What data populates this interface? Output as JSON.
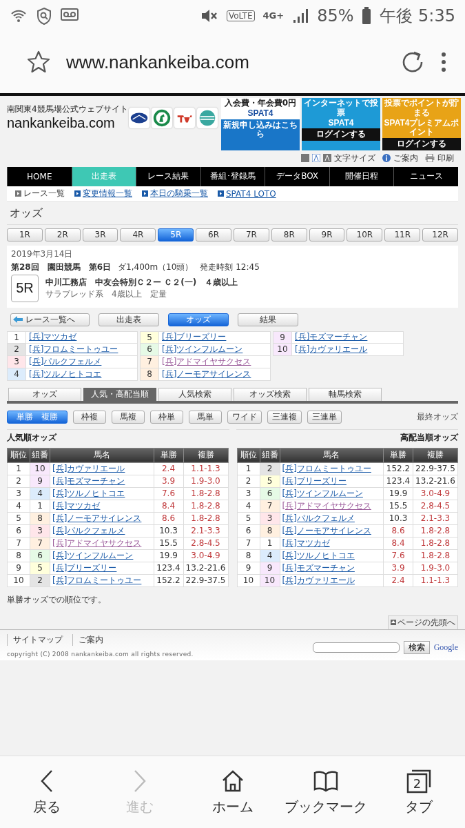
{
  "status_bar": {
    "volte": "VoLTE",
    "network": "4G+",
    "battery": "85%",
    "time": "午後 5:35"
  },
  "browser": {
    "url": "www.nankankeiba.com"
  },
  "site": {
    "tagline": "南関東4競馬場公式ウェブサイト",
    "logo": "nankankeiba.com",
    "banners": [
      {
        "top": "入会費・年会費0円",
        "title": "SPAT4",
        "bottom": "新規申し込みはこちら",
        "color": "#1976c8"
      },
      {
        "top": "インターネットで投票",
        "title": "SPAT4",
        "bottom": "ログインする",
        "color": "#1e9ad6"
      },
      {
        "top": "投票でポイントが貯まる",
        "title": "SPAT4プレミアムポイント",
        "bottom": "ログインする",
        "color": "#e8a317"
      }
    ],
    "tools": [
      "文字サイズ",
      "ご案内",
      "印刷"
    ]
  },
  "nav": [
    {
      "label": "HOME",
      "selected": false
    },
    {
      "label": "出走表",
      "selected": true
    },
    {
      "label": "レース結果",
      "selected": false
    },
    {
      "label": "番組･登録馬",
      "selected": false
    },
    {
      "label": "データBOX",
      "selected": false
    },
    {
      "label": "開催日程",
      "selected": false
    },
    {
      "label": "ニュース",
      "selected": false
    }
  ],
  "subnav": [
    {
      "label": "レース一覧",
      "kind": "current"
    },
    {
      "label": "変更情報一覧",
      "kind": "link"
    },
    {
      "label": "本日の騎乗一覧",
      "kind": "link"
    },
    {
      "label": "SPAT4 LOTO",
      "kind": "link"
    }
  ],
  "page_title": "オッズ",
  "race_tabs": [
    {
      "label": "1R",
      "selected": false
    },
    {
      "label": "2R",
      "selected": false
    },
    {
      "label": "3R",
      "selected": false
    },
    {
      "label": "4R",
      "selected": false
    },
    {
      "label": "5R",
      "selected": true
    },
    {
      "label": "6R",
      "selected": false
    },
    {
      "label": "7R",
      "selected": false
    },
    {
      "label": "8R",
      "selected": false
    },
    {
      "label": "9R",
      "selected": false
    },
    {
      "label": "10R",
      "selected": false
    },
    {
      "label": "11R",
      "selected": false
    },
    {
      "label": "12R",
      "selected": false
    }
  ],
  "race": {
    "date": "2019年3月14日",
    "meeting": "第28回　園田競馬　第6日",
    "course": "ダ1,400m（10頭）",
    "start": "発走時刻 12:45",
    "number": "5R",
    "name": "中川工務店　中友会特別Ｃ２ー Ｃ２(一)　４歳以上",
    "conditions": "サラブレッド系　4歳以上　定量"
  },
  "race_links": [
    {
      "label": "レース一覧へ",
      "kind": "back",
      "selected": false
    },
    {
      "label": "出走表",
      "kind": "plain",
      "selected": false
    },
    {
      "label": "オッズ",
      "kind": "plain",
      "selected": true
    },
    {
      "label": "結果",
      "kind": "plain",
      "selected": false
    }
  ],
  "entries": [
    {
      "number": "1",
      "name": "[兵]マツカゼ",
      "color": "#ffffff",
      "visited": false
    },
    {
      "number": "2",
      "name": "[兵]フロムミートゥユー",
      "color": "#e4e4e4",
      "visited": false
    },
    {
      "number": "3",
      "name": "[兵]パルクフェルメ",
      "color": "#ffe6ea",
      "visited": false
    },
    {
      "number": "4",
      "name": "[兵]ツルノヒトコエ",
      "color": "#dcecfc",
      "visited": false
    },
    {
      "number": "5",
      "name": "[兵]ブリーズリー",
      "color": "#ffffdc",
      "visited": false
    },
    {
      "number": "6",
      "name": "[兵]ツインフルムーン",
      "color": "#e6fae6",
      "visited": false
    },
    {
      "number": "7",
      "name": "[兵]アドマイヤサクセス",
      "color": "#fff0e0",
      "visited": true
    },
    {
      "number": "8",
      "name": "[兵]ノーモアサイレンス",
      "color": "#fff0e0",
      "visited": false
    },
    {
      "number": "9",
      "name": "[兵]モズマーチャン",
      "color": "#f8e8fc",
      "visited": false
    },
    {
      "number": "10",
      "name": "[兵]カヴァリエール",
      "color": "#f8e8fc",
      "visited": false
    }
  ],
  "odds_tabs": [
    {
      "label": "オッズ",
      "selected": false
    },
    {
      "label": "人気・高配当順",
      "selected": true
    },
    {
      "label": "人気検索",
      "selected": false
    },
    {
      "label": "オッズ検索",
      "selected": false
    },
    {
      "label": "軸馬検索",
      "selected": false
    }
  ],
  "bet_types": [
    {
      "label": "単勝　複勝",
      "selected": true
    },
    {
      "label": "枠複",
      "selected": false
    },
    {
      "label": "馬複",
      "selected": false
    },
    {
      "label": "枠単",
      "selected": false
    },
    {
      "label": "馬単",
      "selected": false
    },
    {
      "label": "ワイド",
      "selected": false
    },
    {
      "label": "三連複",
      "selected": false
    },
    {
      "label": "三連単",
      "selected": false
    }
  ],
  "odds_note": "最終オッズ",
  "tables": [
    {
      "title": "人気順オッズ",
      "columns": [
        "順位",
        "組番",
        "馬名",
        "単勝",
        "複勝"
      ],
      "rows": [
        {
          "rank": "1",
          "number": "10",
          "color": "#f8e8fc",
          "name": "[兵]カヴァリエール",
          "visited": false,
          "win": "2.4",
          "win_highlight": true,
          "place": "1.1-1.3",
          "place_highlight": true
        },
        {
          "rank": "2",
          "number": "9",
          "color": "#f8e8fc",
          "name": "[兵]モズマーチャン",
          "visited": false,
          "win": "3.9",
          "win_highlight": true,
          "place": "1.9-3.0",
          "place_highlight": true
        },
        {
          "rank": "3",
          "number": "4",
          "color": "#dcecfc",
          "name": "[兵]ツルノヒトコエ",
          "visited": false,
          "win": "7.6",
          "win_highlight": true,
          "place": "1.8-2.8",
          "place_highlight": true
        },
        {
          "rank": "4",
          "number": "1",
          "color": "#ffffff",
          "name": "[兵]マツカゼ",
          "visited": false,
          "win": "8.4",
          "win_highlight": true,
          "place": "1.8-2.8",
          "place_highlight": true
        },
        {
          "rank": "5",
          "number": "8",
          "color": "#fff0e0",
          "name": "[兵]ノーモアサイレンス",
          "visited": false,
          "win": "8.6",
          "win_highlight": true,
          "place": "1.8-2.8",
          "place_highlight": true
        },
        {
          "rank": "6",
          "number": "3",
          "color": "#ffe6ea",
          "name": "[兵]パルクフェルメ",
          "visited": false,
          "win": "10.3",
          "win_highlight": false,
          "place": "2.1-3.3",
          "place_highlight": true
        },
        {
          "rank": "7",
          "number": "7",
          "color": "#fff0e0",
          "name": "[兵]アドマイヤサクセス",
          "visited": true,
          "win": "15.5",
          "win_highlight": false,
          "place": "2.8-4.5",
          "place_highlight": true
        },
        {
          "rank": "8",
          "number": "6",
          "color": "#e6fae6",
          "name": "[兵]ツインフルムーン",
          "visited": false,
          "win": "19.9",
          "win_highlight": false,
          "place": "3.0-4.9",
          "place_highlight": true
        },
        {
          "rank": "9",
          "number": "5",
          "color": "#ffffdc",
          "name": "[兵]ブリーズリー",
          "visited": false,
          "win": "123.4",
          "win_highlight": false,
          "place": "13.2-21.6",
          "place_highlight": false
        },
        {
          "rank": "10",
          "number": "2",
          "color": "#e4e4e4",
          "name": "[兵]フロムミートゥユー",
          "visited": false,
          "win": "152.2",
          "win_highlight": false,
          "place": "22.9-37.5",
          "place_highlight": false
        }
      ]
    },
    {
      "title": "高配当順オッズ",
      "columns": [
        "順位",
        "組番",
        "馬名",
        "単勝",
        "複勝"
      ],
      "rows": [
        {
          "rank": "1",
          "number": "2",
          "color": "#e4e4e4",
          "name": "[兵]フロムミートゥユー",
          "visited": false,
          "win": "152.2",
          "win_highlight": false,
          "place": "22.9-37.5",
          "place_highlight": false
        },
        {
          "rank": "2",
          "number": "5",
          "color": "#ffffdc",
          "name": "[兵]ブリーズリー",
          "visited": false,
          "win": "123.4",
          "win_highlight": false,
          "place": "13.2-21.6",
          "place_highlight": false
        },
        {
          "rank": "3",
          "number": "6",
          "color": "#e6fae6",
          "name": "[兵]ツインフルムーン",
          "visited": false,
          "win": "19.9",
          "win_highlight": false,
          "place": "3.0-4.9",
          "place_highlight": true
        },
        {
          "rank": "4",
          "number": "7",
          "color": "#fff0e0",
          "name": "[兵]アドマイヤサクセス",
          "visited": true,
          "win": "15.5",
          "win_highlight": false,
          "place": "2.8-4.5",
          "place_highlight": true
        },
        {
          "rank": "5",
          "number": "3",
          "color": "#ffe6ea",
          "name": "[兵]パルクフェルメ",
          "visited": false,
          "win": "10.3",
          "win_highlight": false,
          "place": "2.1-3.3",
          "place_highlight": true
        },
        {
          "rank": "6",
          "number": "8",
          "color": "#fff0e0",
          "name": "[兵]ノーモアサイレンス",
          "visited": false,
          "win": "8.6",
          "win_highlight": true,
          "place": "1.8-2.8",
          "place_highlight": true
        },
        {
          "rank": "7",
          "number": "1",
          "color": "#ffffff",
          "name": "[兵]マツカゼ",
          "visited": false,
          "win": "8.4",
          "win_highlight": true,
          "place": "1.8-2.8",
          "place_highlight": true
        },
        {
          "rank": "8",
          "number": "4",
          "color": "#dcecfc",
          "name": "[兵]ツルノヒトコエ",
          "visited": false,
          "win": "7.6",
          "win_highlight": true,
          "place": "1.8-2.8",
          "place_highlight": true
        },
        {
          "rank": "9",
          "number": "9",
          "color": "#f8e8fc",
          "name": "[兵]モズマーチャン",
          "visited": false,
          "win": "3.9",
          "win_highlight": true,
          "place": "1.9-3.0",
          "place_highlight": true
        },
        {
          "rank": "10",
          "number": "10",
          "color": "#f8e8fc",
          "name": "[兵]カヴァリエール",
          "visited": false,
          "win": "2.4",
          "win_highlight": true,
          "place": "1.1-1.3",
          "place_highlight": true
        }
      ]
    }
  ],
  "footnote": "単勝オッズでの順位です。",
  "page_top": "ページの先頭へ",
  "footer": {
    "links": [
      "サイトマップ",
      "ご案内"
    ],
    "copyright": "copyright (C) 2008 nankankeiba.com all rights reserved.",
    "search_button": "検索",
    "search_logo": "Google"
  },
  "bottom_nav": [
    {
      "label": "戻る",
      "kind": "back",
      "disabled": false
    },
    {
      "label": "進む",
      "kind": "forward",
      "disabled": true
    },
    {
      "label": "ホーム",
      "kind": "home",
      "disabled": false
    },
    {
      "label": "ブックマーク",
      "kind": "bookmark",
      "disabled": false
    },
    {
      "label": "タブ",
      "kind": "tabs",
      "disabled": false,
      "count": "2"
    }
  ]
}
